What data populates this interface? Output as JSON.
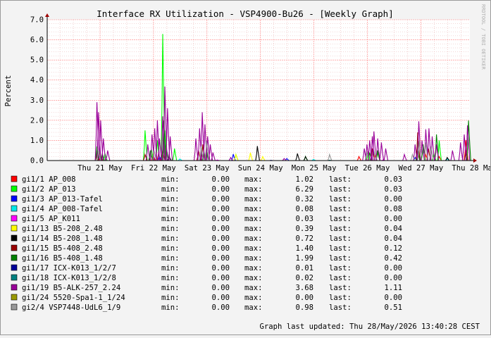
{
  "chart_data": {
    "type": "line",
    "title": "Interface RX Utilization - VSP4900-Bu26 - [Weekly Graph]",
    "ylabel": "Percent",
    "xlabel": "",
    "ylim": [
      0,
      7
    ],
    "yticks": [
      "0.0",
      "1.0",
      "2.0",
      "3.0",
      "4.0",
      "5.0",
      "6.0",
      "7.0"
    ],
    "xticks": [
      "Thu 21 May",
      "Fri 22 May",
      "Sat 23 May",
      "Sun 24 May",
      "Mon 25 May",
      "Tue 26 May",
      "Wed 27 May",
      "Thu 28 May"
    ],
    "grid": true,
    "watermark": "RRDTOOL / TOBI OETIKER",
    "footer": "Graph last updated: Thu 28/May/2026 13:40:28 CEST",
    "legend_columns": {
      "min": "min:",
      "max": "max:",
      "last": "last:"
    },
    "series": [
      {
        "name": "gi1/1 AP_008",
        "color": "#ff0000",
        "min": "0.00",
        "max": "1.02",
        "last": "0.03",
        "peaks": [
          [
            -0.05,
            0.3
          ],
          [
            0.02,
            0.2
          ],
          [
            1.0,
            0.3
          ],
          [
            1.1,
            0.3
          ],
          [
            1.95,
            0.25
          ],
          [
            4.85,
            0.2
          ],
          [
            5.15,
            0.25
          ],
          [
            5.95,
            0.4
          ],
          [
            6.1,
            0.3
          ],
          [
            6.35,
            0.2
          ],
          [
            6.85,
            1.02
          ],
          [
            6.98,
            0.3
          ]
        ]
      },
      {
        "name": "gi1/2 AP_013",
        "color": "#00ff00",
        "min": "0.00",
        "max": "6.29",
        "last": "0.03",
        "peaks": [
          [
            -0.05,
            0.7
          ],
          [
            0.0,
            0.5
          ],
          [
            0.1,
            0.35
          ],
          [
            0.85,
            1.5
          ],
          [
            0.97,
            0.55
          ],
          [
            1.08,
            1.0
          ],
          [
            1.18,
            6.29
          ],
          [
            1.22,
            1.5
          ],
          [
            1.4,
            0.6
          ],
          [
            1.95,
            0.45
          ],
          [
            2.0,
            0.35
          ],
          [
            2.55,
            0.3
          ],
          [
            3.85,
            0.2
          ],
          [
            5.02,
            0.45
          ],
          [
            5.2,
            0.4
          ],
          [
            5.95,
            1.2
          ],
          [
            6.25,
            0.35
          ],
          [
            6.35,
            1.0
          ]
        ]
      },
      {
        "name": "gi1/3 AP_013-Tafel",
        "color": "#0000ff",
        "min": "0.00",
        "max": "0.32",
        "last": "0.00",
        "peaks": [
          [
            1.12,
            0.2
          ],
          [
            2.5,
            0.32
          ],
          [
            3.5,
            0.1
          ],
          [
            5.9,
            0.15
          ]
        ]
      },
      {
        "name": "gi1/4 AP_008-Tafel",
        "color": "#00e8e8",
        "min": "0.00",
        "max": "0.08",
        "last": "0.08",
        "peaks": [
          [
            1.5,
            0.08
          ],
          [
            4.0,
            0.06
          ],
          [
            6.5,
            0.08
          ]
        ]
      },
      {
        "name": "gi1/5 AP_K011",
        "color": "#ff00ff",
        "min": "0.00",
        "max": "0.03",
        "last": "0.00",
        "peaks": [
          [
            2.2,
            0.03
          ],
          [
            5.3,
            0.03
          ]
        ]
      },
      {
        "name": "gi1/13 B5-208_2.48",
        "color": "#ffff00",
        "min": "0.00",
        "max": "0.39",
        "last": "0.04",
        "peaks": [
          [
            2.55,
            0.3
          ],
          [
            2.82,
            0.39
          ],
          [
            3.05,
            0.2
          ]
        ]
      },
      {
        "name": "gi1/14 B5-208_1.48",
        "color": "#000000",
        "min": "0.00",
        "max": "0.72",
        "last": "0.04",
        "peaks": [
          [
            2.95,
            0.72
          ],
          [
            3.7,
            0.35
          ],
          [
            3.85,
            0.2
          ],
          [
            1.3,
            0.2
          ],
          [
            6.5,
            0.15
          ]
        ]
      },
      {
        "name": "gi1/15 B5-408_2.48",
        "color": "#990000",
        "min": "0.00",
        "max": "1.40",
        "last": "0.12",
        "peaks": [
          [
            0.0,
            0.4
          ],
          [
            0.85,
            0.3
          ],
          [
            1.18,
            0.5
          ],
          [
            1.85,
            0.5
          ],
          [
            1.93,
            0.8
          ],
          [
            5.1,
            0.6
          ],
          [
            5.2,
            0.5
          ],
          [
            5.95,
            1.4
          ],
          [
            6.15,
            0.6
          ],
          [
            6.85,
            0.5
          ]
        ]
      },
      {
        "name": "gi1/16 B5-408_1.48",
        "color": "#008000",
        "min": "0.00",
        "max": "1.99",
        "last": "0.42",
        "peaks": [
          [
            -0.05,
            0.5
          ],
          [
            0.05,
            0.35
          ],
          [
            0.95,
            0.5
          ],
          [
            1.2,
            1.99
          ],
          [
            1.25,
            0.6
          ],
          [
            1.9,
            0.6
          ],
          [
            2.0,
            0.5
          ],
          [
            5.05,
            0.4
          ],
          [
            5.2,
            0.5
          ],
          [
            5.95,
            0.5
          ],
          [
            6.05,
            0.8
          ],
          [
            6.3,
            1.3
          ],
          [
            6.9,
            1.99
          ],
          [
            6.97,
            0.42
          ]
        ]
      },
      {
        "name": "gi1/17 ICX-K013_1/2/7",
        "color": "#000099",
        "min": "0.00",
        "max": "0.01",
        "last": "0.00",
        "peaks": [
          [
            3.2,
            0.01
          ]
        ]
      },
      {
        "name": "gi1/18 ICX-K013_1/2/8",
        "color": "#008080",
        "min": "0.00",
        "max": "0.02",
        "last": "0.00",
        "peaks": [
          [
            4.3,
            0.02
          ]
        ]
      },
      {
        "name": "gi1/19 B5-ALK-257_2.24",
        "color": "#990099",
        "min": "0.00",
        "max": "3.68",
        "last": "1.11",
        "peaks": [
          [
            -0.05,
            2.9
          ],
          [
            -0.02,
            2.4
          ],
          [
            0.02,
            2.0
          ],
          [
            0.07,
            1.1
          ],
          [
            0.15,
            0.5
          ],
          [
            0.9,
            0.8
          ],
          [
            0.98,
            1.3
          ],
          [
            1.03,
            1.6
          ],
          [
            1.08,
            2.0
          ],
          [
            1.12,
            1.1
          ],
          [
            1.18,
            2.2
          ],
          [
            1.22,
            3.68
          ],
          [
            1.27,
            2.6
          ],
          [
            1.32,
            1.2
          ],
          [
            1.8,
            1.1
          ],
          [
            1.87,
            1.6
          ],
          [
            1.92,
            2.4
          ],
          [
            1.97,
            1.8
          ],
          [
            2.02,
            1.2
          ],
          [
            2.07,
            0.8
          ],
          [
            2.12,
            0.4
          ],
          [
            2.45,
            0.15
          ],
          [
            3.45,
            0.1
          ],
          [
            4.95,
            0.6
          ],
          [
            5.0,
            0.8
          ],
          [
            5.05,
            1.0
          ],
          [
            5.1,
            1.2
          ],
          [
            5.13,
            1.45
          ],
          [
            5.2,
            1.1
          ],
          [
            5.27,
            0.9
          ],
          [
            5.35,
            0.6
          ],
          [
            5.7,
            0.3
          ],
          [
            5.9,
            0.8
          ],
          [
            5.97,
            1.95
          ],
          [
            6.03,
            1.0
          ],
          [
            6.1,
            1.55
          ],
          [
            6.16,
            1.6
          ],
          [
            6.22,
            1.2
          ],
          [
            6.3,
            0.8
          ],
          [
            6.6,
            0.5
          ],
          [
            6.75,
            0.9
          ],
          [
            6.82,
            1.3
          ],
          [
            6.88,
            1.75
          ],
          [
            6.93,
            1.5
          ],
          [
            6.98,
            1.11
          ]
        ]
      },
      {
        "name": "gi1/24 5520-Spa1-1_1/24",
        "color": "#999900",
        "min": "0.00",
        "max": "0.00",
        "last": "0.00",
        "peaks": []
      },
      {
        "name": "gi2/4 VSP7448-UdL6_1/9",
        "color": "#999999",
        "min": "0.00",
        "max": "0.98",
        "last": "0.51",
        "peaks": [
          [
            -0.02,
            0.5
          ],
          [
            1.02,
            0.5
          ],
          [
            1.9,
            0.7
          ],
          [
            2.0,
            0.98
          ],
          [
            4.3,
            0.3
          ],
          [
            5.0,
            0.4
          ],
          [
            5.15,
            0.5
          ],
          [
            5.85,
            0.3
          ],
          [
            5.98,
            0.98
          ],
          [
            6.1,
            0.9
          ],
          [
            6.2,
            0.7
          ],
          [
            6.92,
            0.51
          ]
        ]
      }
    ]
  }
}
